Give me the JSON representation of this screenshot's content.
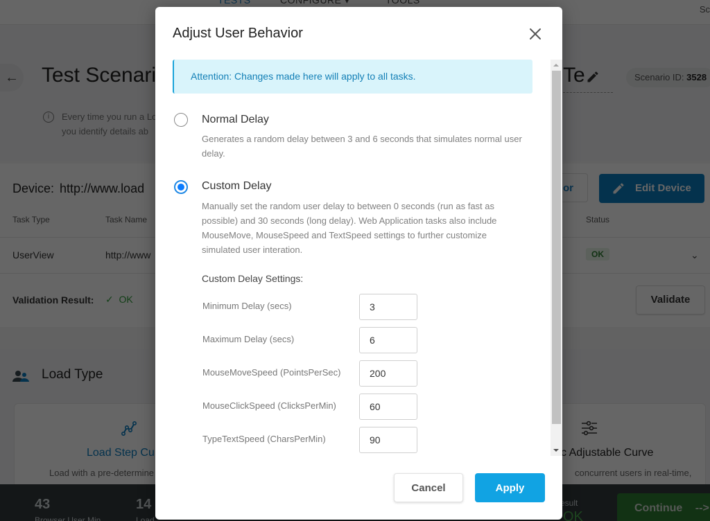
{
  "topnav": {
    "items": [
      "TESTS",
      "CONFIGURE",
      "TOOLS"
    ],
    "configure_caret": "▾",
    "right_text": "Sc"
  },
  "header": {
    "back_icon": "arrow-left-icon",
    "title": "Test Scenario",
    "title_tail": "Te",
    "scenario_id_label": "Scenario ID:",
    "scenario_id_value": "3528",
    "info_text_line1": "Every time you run a Lo",
    "info_text_line2": "you identify details ab"
  },
  "device": {
    "label": "Device:",
    "url": "http://www.load",
    "partial_button_label": "or",
    "edit_button_label": "Edit Device",
    "table_headers": [
      "Task Type",
      "Task Name",
      "Status"
    ],
    "rows": [
      {
        "task_type": "UserView",
        "task_name": "http://www",
        "status": "OK"
      }
    ],
    "validation_label": "Validation Result:",
    "validation_value": "OK",
    "validate_button_label": "Validate"
  },
  "load_type": {
    "title": "Load Type",
    "cards": [
      {
        "name": "Load Step Cu",
        "description_line1": "Load with a pre-determine",
        "icon": "curve-points-icon"
      },
      {
        "name": "c Adjustable Curve",
        "description_line1": "concurrent users in real-time,",
        "icon": "sliders-icon"
      }
    ]
  },
  "bottom_bar": {
    "stats": [
      {
        "value": "43",
        "label": "Browser User Min"
      },
      {
        "value": "14",
        "label": "Load"
      }
    ],
    "result_label": "esult",
    "result_value": "OK",
    "continue_label": "Continue",
    "continue_arrow": "-->"
  },
  "modal": {
    "title": "Adjust User Behavior",
    "alert": "Attention: Changes made here will apply to all tasks.",
    "options": [
      {
        "label": "Normal Delay",
        "selected": false,
        "description": "Generates a random delay between 3 and 6 seconds that simulates normal user delay."
      },
      {
        "label": "Custom Delay",
        "selected": true,
        "description": "Manually set the random user delay to between 0 seconds (run as fast as possible) and 30 seconds (long delay). Web Application tasks also include MouseMove, MouseSpeed and TextSpeed settings to further customize simulated user interation."
      }
    ],
    "settings_title": "Custom Delay Settings:",
    "settings": [
      {
        "label": "Minimum Delay (secs)",
        "value": "3"
      },
      {
        "label": "Maximum Delay (secs)",
        "value": "6"
      },
      {
        "label": "MouseMoveSpeed (PointsPerSec)",
        "value": "200"
      },
      {
        "label": "MouseClickSpeed (ClicksPerMin)",
        "value": "60"
      },
      {
        "label": "TypeTextSpeed (CharsPerMin)",
        "value": "90"
      }
    ],
    "cancel_label": "Cancel",
    "apply_label": "Apply",
    "colors": {
      "accent": "#11a3e3",
      "radio_selected": "#0a7cff",
      "alert_bg": "#d9f4fb",
      "alert_text": "#137fb6"
    }
  }
}
